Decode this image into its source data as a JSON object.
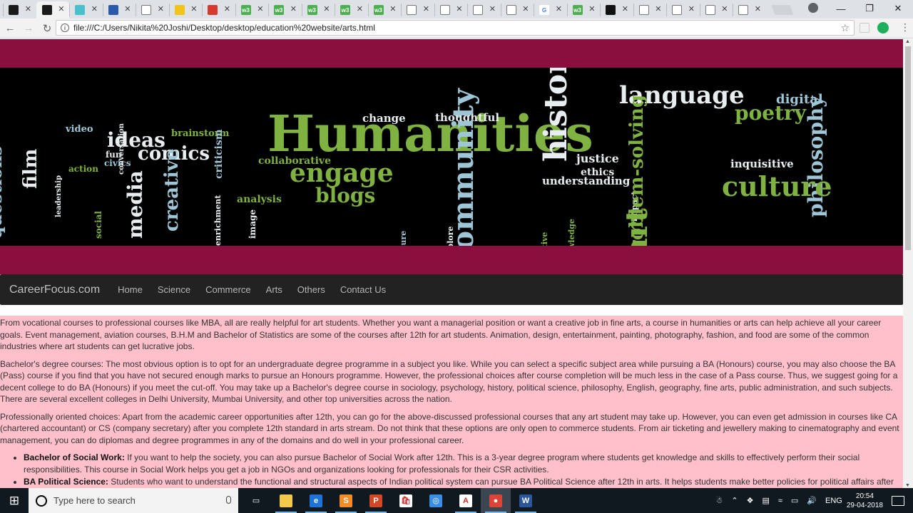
{
  "browser": {
    "tabs": [
      {
        "favicon": "tab-icon",
        "color": "#1a1a1a"
      },
      {
        "favicon": "tab-icon",
        "color": "#1a1a1a",
        "active": true
      },
      {
        "favicon": "tab-icon",
        "color": "#48c0ce"
      },
      {
        "favicon": "tab-icon",
        "color": "#2a5ba8"
      },
      {
        "favicon": "doc-icon",
        "color": "#ffffff"
      },
      {
        "favicon": "tab-icon",
        "color": "#f0c419"
      },
      {
        "favicon": "tab-icon",
        "color": "#d63a2f"
      },
      {
        "favicon": "w3-icon",
        "color": "#4caf50",
        "label": "w3"
      },
      {
        "favicon": "w3-icon",
        "color": "#4caf50",
        "label": "w3"
      },
      {
        "favicon": "w3-icon",
        "color": "#4caf50",
        "label": "w3"
      },
      {
        "favicon": "w3-icon",
        "color": "#4caf50",
        "label": "w3"
      },
      {
        "favicon": "w3-icon",
        "color": "#4caf50",
        "label": "w3"
      },
      {
        "favicon": "doc-icon",
        "color": "#ffffff"
      },
      {
        "favicon": "doc-icon",
        "color": "#ffffff"
      },
      {
        "favicon": "doc-icon",
        "color": "#ffffff"
      },
      {
        "favicon": "doc-icon",
        "color": "#ffffff"
      },
      {
        "favicon": "google-icon",
        "color": "#ffffff",
        "label": "G"
      },
      {
        "favicon": "w3-icon",
        "color": "#4caf50",
        "label": "w3"
      },
      {
        "favicon": "github-icon",
        "color": "#111111"
      },
      {
        "favicon": "doc-icon",
        "color": "#ffffff"
      },
      {
        "favicon": "doc-icon",
        "color": "#ffffff"
      },
      {
        "favicon": "doc-icon",
        "color": "#ffffff"
      },
      {
        "favicon": "doc-icon",
        "color": "#ffffff"
      }
    ],
    "url": "file:///C:/Users/Nikita%20Joshi/Desktop/desktop/education%20website/arts.html"
  },
  "page": {
    "banner_words": [
      "language",
      "digital",
      "poetry",
      "Humanities",
      "history",
      "change",
      "thoughtful",
      "video",
      "ideas",
      "brainstorm",
      "comics",
      "fun",
      "civics",
      "questions",
      "film",
      "leadership",
      "action",
      "social",
      "media",
      "creative",
      "conversation",
      "criticism",
      "collaborative",
      "engage",
      "enrichment",
      "image",
      "analysis",
      "blogs",
      "justice",
      "ethics",
      "inquisitive",
      "philosophy",
      "understanding",
      "culture",
      "literature",
      "explore",
      "community",
      "impact",
      "initiative",
      "knowledge",
      "art",
      "problem-solving"
    ],
    "brand": "CareerFocus.com",
    "nav": [
      "Home",
      "Science",
      "Commerce",
      "Arts",
      "Others",
      "Contact Us"
    ],
    "paragraphs": [
      "From vocational courses to professional courses like MBA, all are really helpful for art students. Whether you want a managerial position or want a creative job in fine arts, a course in humanities or arts can help achieve all your career goals. Event management, aviation courses, B.H.M and Bachelor of Statistics are some of the courses after 12th for art students. Animation, design, entertainment, painting, photography, fashion, and food are some of the common industries where art students can get lucrative jobs.",
      "Bachelor's degree courses: The most obvious option is to opt for an undergraduate degree programme in a subject you like. While you can select a specific subject area while pursuing a BA (Honours) course, you may also choose the BA (Pass) course if you find that you have not secured enough marks to pursue an Honours programme. However, the professional choices after course completion will be much less in the case of a Pass course. Thus, we suggest going for a decent college to do BA (Honours) if you meet the cut-off. You may take up a Bachelor's degree course in sociology, psychology, history, political science, philosophy, English, geography, fine arts, public administration, and such subjects. There are several excellent colleges in Delhi University, Mumbai University, and other top universities across the nation.",
      "Professionally oriented choices: Apart from the academic career opportunities after 12th, you can go for the above-discussed professional courses that any art student may take up. However, you can even get admission in courses like CA (chartered accountant) or CS (company secretary) after you complete 12th standard in arts stream. Do not think that these options are only open to commerce students. From air ticketing and jewellery making to cinematography and event management, you can do diplomas and degree programmes in any of the domains and do well in your professional career."
    ],
    "list": [
      {
        "title": "Bachelor of Social Work:",
        "text": " If you want to help the society, you can also pursue Bachelor of Social Work after 12th. This is a 3-year degree program where students get knowledge and skills to effectively perform their social responsibilities. This course in Social Work helps you get a job in NGOs and organizations looking for professionals for their CSR activities."
      },
      {
        "title": "BA Political Science:",
        "text": " Students who want to understand the functional and structural aspects of Indian political system can pursue BA Political Science after 12th in arts. It helps students make better policies for political affairs after opting"
      }
    ]
  },
  "taskbar": {
    "search_placeholder": "Type here to search",
    "apps": [
      {
        "icon": "task-view-icon",
        "color": "transparent",
        "glyph": "▭"
      },
      {
        "icon": "file-explorer-icon",
        "color": "#f2c94c",
        "glyph": ""
      },
      {
        "icon": "edge-icon",
        "color": "#1e73d8",
        "glyph": "e"
      },
      {
        "icon": "sublime-icon",
        "color": "#f28c28",
        "glyph": "S"
      },
      {
        "icon": "powerpoint-icon",
        "color": "#d24726",
        "glyph": "P"
      },
      {
        "icon": "store-icon",
        "color": "#ffffff",
        "glyph": "🛍"
      },
      {
        "icon": "safari-icon",
        "color": "#3a8ee6",
        "glyph": "◎"
      },
      {
        "icon": "pdf-icon",
        "color": "#ffffff",
        "glyph": "A"
      },
      {
        "icon": "chrome-icon",
        "color": "#db4437",
        "glyph": "●",
        "active": true
      },
      {
        "icon": "word-icon",
        "color": "#2b579a",
        "glyph": "W"
      }
    ],
    "language": "ENG",
    "time": "20:54",
    "date": "29-04-2018"
  }
}
